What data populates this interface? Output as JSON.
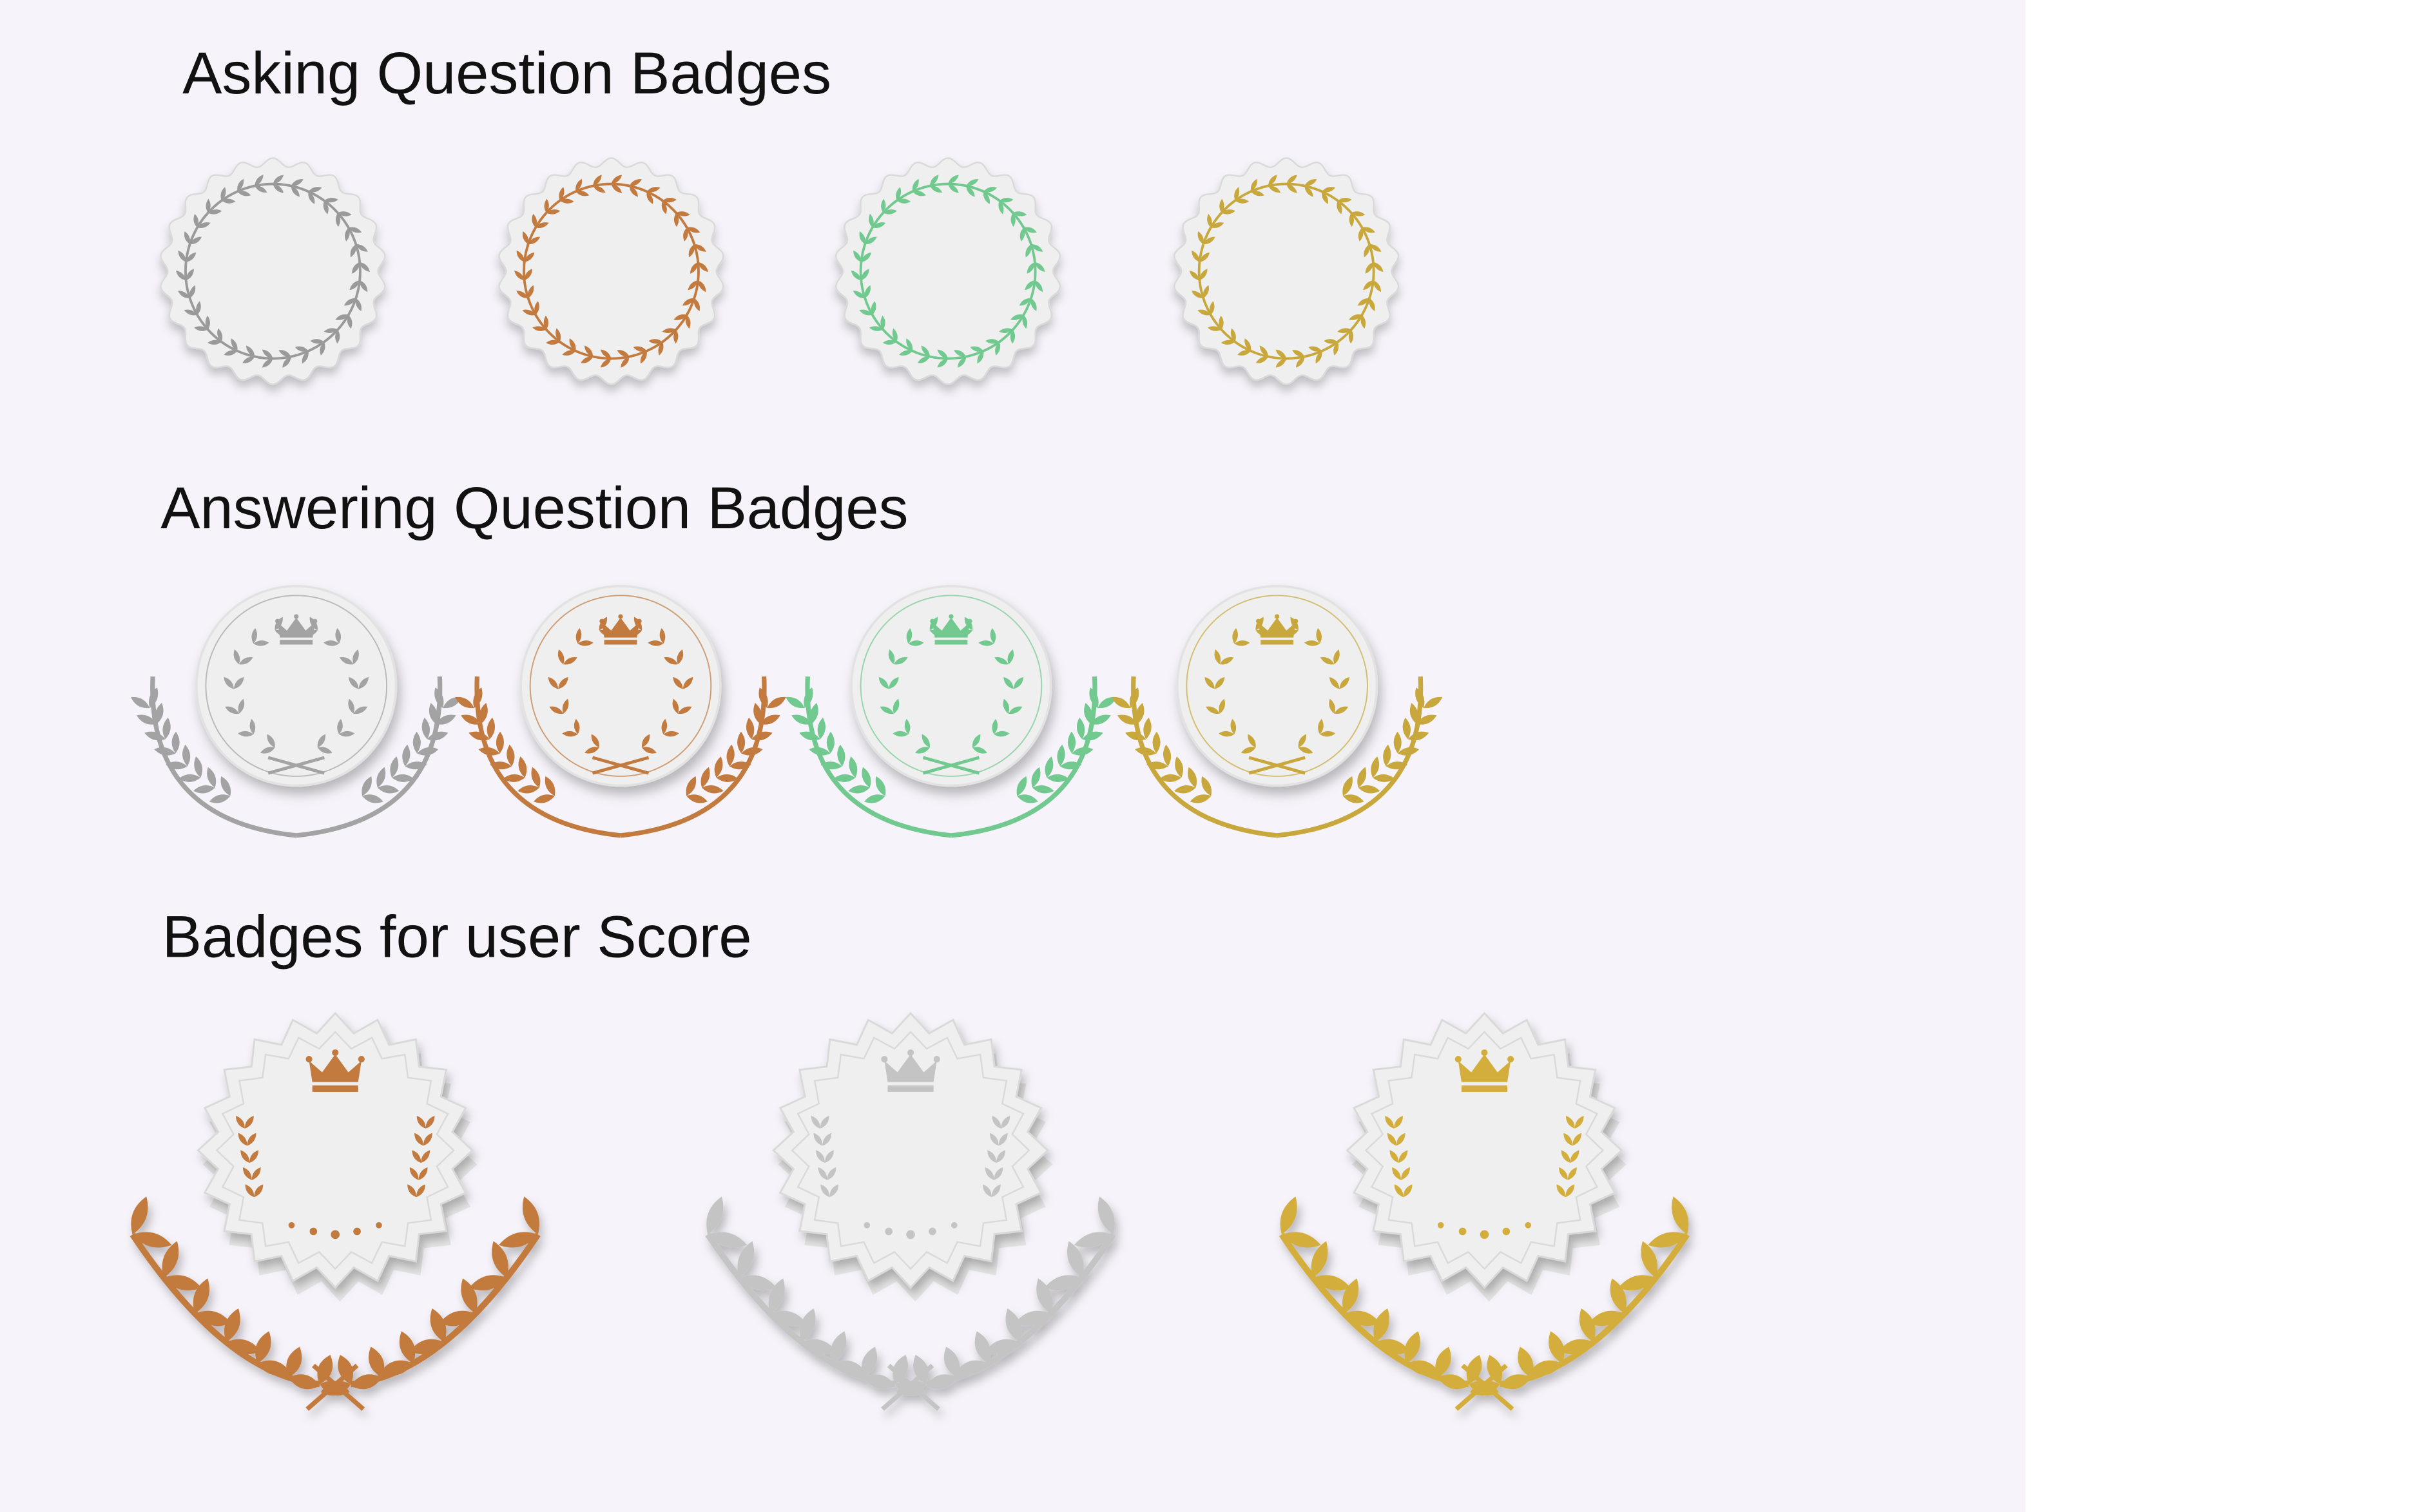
{
  "sections": {
    "asking": {
      "title": "Asking Question Badges",
      "badges": [
        {
          "tier": "silver",
          "color": "#9a9a9a"
        },
        {
          "tier": "bronze",
          "color": "#c27a3e"
        },
        {
          "tier": "green",
          "color": "#72c98f"
        },
        {
          "tier": "gold",
          "color": "#c8a83c"
        }
      ]
    },
    "answering": {
      "title": "Answering Question Badges",
      "badges": [
        {
          "tier": "silver",
          "color": "#a3a3a3"
        },
        {
          "tier": "bronze",
          "color": "#c27a3e"
        },
        {
          "tier": "green",
          "color": "#72c98f"
        },
        {
          "tier": "gold",
          "color": "#c8a83c"
        }
      ]
    },
    "score": {
      "title": "Badges for user Score",
      "badges": [
        {
          "tier": "bronze",
          "color": "#c27a3e"
        },
        {
          "tier": "silver",
          "color": "#c4c4c4"
        },
        {
          "tier": "gold",
          "color": "#d4ae3c"
        }
      ]
    }
  },
  "colors": {
    "background": "#f6f4fa",
    "badge_face": "#efefef",
    "badge_edge": "#d9d9d9"
  }
}
